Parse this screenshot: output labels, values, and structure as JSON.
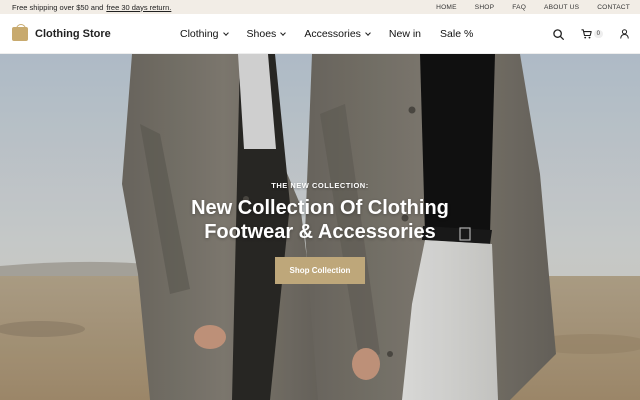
{
  "topbar": {
    "promo_text": "Free shipping over $50 and",
    "promo_link": "free 30 days return.",
    "links": [
      "HOME",
      "SHOP",
      "FAQ",
      "ABOUT US",
      "CONTACT"
    ]
  },
  "header": {
    "brand": "Clothing Store",
    "nav": [
      {
        "label": "Clothing"
      },
      {
        "label": "Shoes"
      },
      {
        "label": "Accessories"
      },
      {
        "label": "New in"
      },
      {
        "label": "Sale %"
      }
    ],
    "cart_count": "0"
  },
  "hero": {
    "eyebrow": "THE NEW COLLECTION:",
    "title_line1": "New Collection Of Clothing",
    "title_line2": "Footwear & Accessories",
    "cta_label": "Shop Collection"
  },
  "colors": {
    "accent": "#bea77a",
    "topbar_bg": "#f2ede6",
    "logo": "#c8aa6e"
  },
  "icons": [
    "bag-logo-icon",
    "search-icon",
    "cart-icon",
    "user-icon",
    "chevron-down-icon"
  ]
}
